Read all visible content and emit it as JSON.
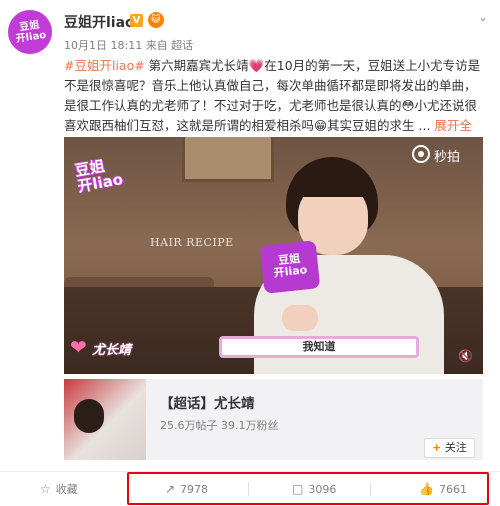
{
  "header": {
    "avatar_text": "豆姐\n开liao",
    "name": "豆姐开liao",
    "verified_icon": "verified-badge-icon",
    "verified_glyph": "V",
    "vip_icon": "vip-icon",
    "vip_glyph": "😺",
    "menu_icon": "chevron-down-icon",
    "meta": "10月1日 18:11 来自 超话"
  },
  "post": {
    "topic": "#豆姐开liao#",
    "body": " 第六期嘉宾尤长靖💗在10月的第一天，豆姐送上小尤专访是不是很惊喜呢？音乐上他认真做自己，每次单曲循环都是即将发出的单曲，是很工作认真的尤老师了！不过对于吃，尤老师也是很认真的😳小尤还说很喜欢跟西柚们互怼，这就是所谓的相爱相杀吗😁其实豆姐的求生 ...",
    "expand": "展开全文",
    "expand_icon": "chevron-down-icon"
  },
  "video": {
    "logo": "豆姐\n开liao",
    "sign_text": "HAIR RECIPE",
    "watermark": "秒拍",
    "mic_card_text": "豆姐\n开liao",
    "name_tag": "尤长靖",
    "subtitle": "我知道",
    "mute_icon": "mute-icon"
  },
  "supertopic": {
    "title": "【超话】尤长靖",
    "stats": "25.6万帖子  39.1万粉丝",
    "follow_plus": "+",
    "follow_label": "关注"
  },
  "actions": {
    "favorite_label": "收藏",
    "repost_count": "7978",
    "comment_count": "3096",
    "like_count": "7661",
    "highlight_color": "#e60012"
  }
}
